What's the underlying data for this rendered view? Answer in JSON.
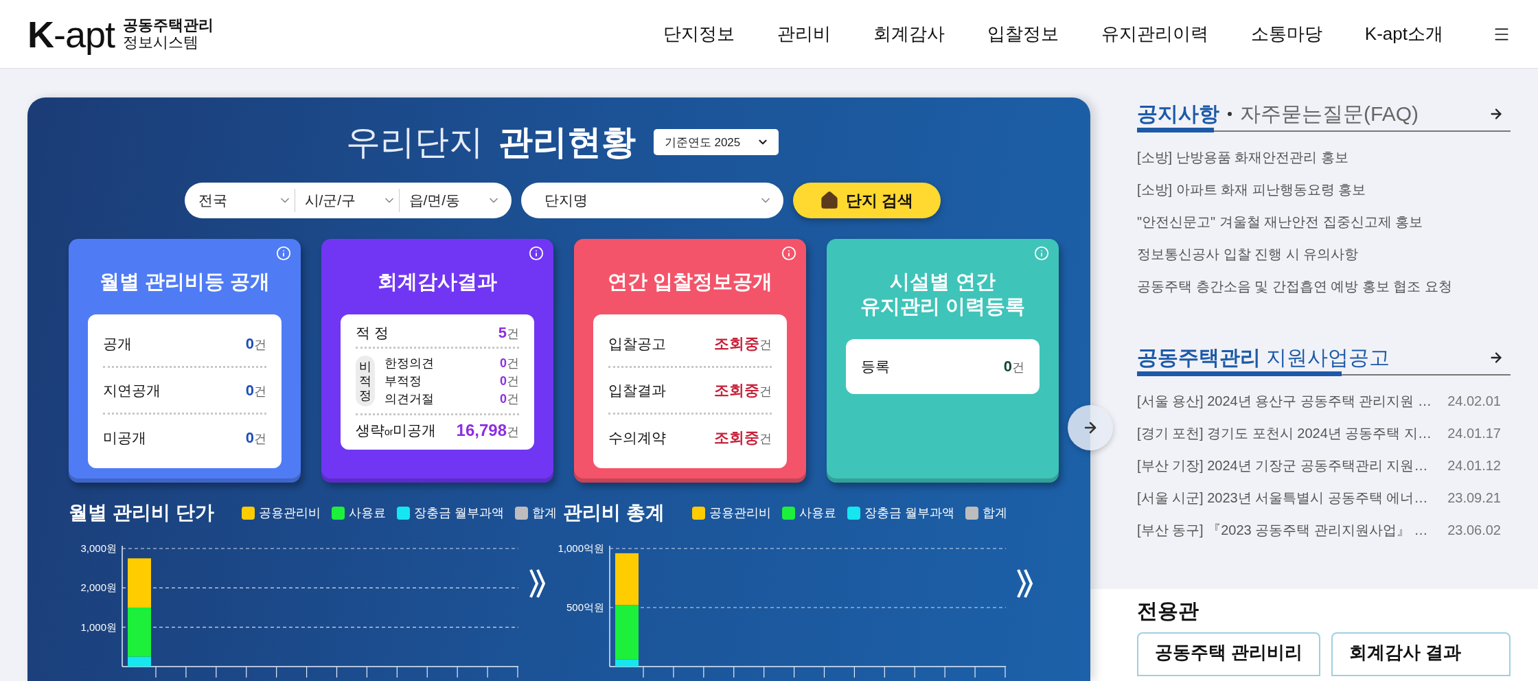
{
  "header": {
    "logo": {
      "mark": "**K**-apt",
      "line1": "공동주택관리",
      "line2": "정보시스템"
    },
    "nav": [
      {
        "label": "단지정보"
      },
      {
        "label": "관리비"
      },
      {
        "label": "회계감사"
      },
      {
        "label": "입찰정보"
      },
      {
        "label": "유지관리이력"
      },
      {
        "label": "소통마당"
      },
      {
        "label": "K-apt소개"
      }
    ]
  },
  "dashboard": {
    "title_light": "우리단지",
    "title_bold": "관리현황",
    "year_select": "기준연도 2025",
    "filters": [
      {
        "value": "전국"
      },
      {
        "value": "시/군/구"
      },
      {
        "value": "읍/면/동"
      }
    ],
    "complex_select": "단지명",
    "search_button": "단지 검색",
    "cards": [
      {
        "kind": "count",
        "title": "월별 관리비등 공개",
        "color": "#4f7cf4",
        "rows": [
          {
            "kind": "row",
            "label": "공개",
            "value": "0",
            "unit": "건"
          },
          {
            "kind": "row",
            "label": "지연공개",
            "value": "0",
            "unit": "건"
          },
          {
            "kind": "row",
            "label": "미공개",
            "value": "0",
            "unit": "건"
          }
        ]
      },
      {
        "kind": "audit",
        "title": "회계감사결과",
        "color": "#7136f4",
        "rows": [
          {
            "kind": "row",
            "label": "적 정",
            "value": "5",
            "unit": "건"
          },
          {
            "kind": "group",
            "label": "비적정",
            "items": [
              {
                "label": "한정의견",
                "value": "0",
                "unit": "건"
              },
              {
                "label": "부적정",
                "value": "0",
                "unit": "건"
              },
              {
                "label": "의견거절",
                "value": "0",
                "unit": "건"
              }
            ]
          },
          {
            "kind": "total",
            "label": "생략$_{or}$미공개",
            "value": "16,798",
            "unit": "건"
          }
        ]
      },
      {
        "kind": "bid",
        "title": "연간 입찰정보공개",
        "color": "#f3546a",
        "rows": [
          {
            "kind": "row",
            "label": "입찰공고",
            "value": "조회중",
            "unit": "건"
          },
          {
            "kind": "row",
            "label": "입찰결과",
            "value": "조회중",
            "unit": "건"
          },
          {
            "kind": "row",
            "label": "수의계약",
            "value": "조회중",
            "unit": "건"
          }
        ]
      },
      {
        "kind": "register",
        "title": "시설별 연간\n유지관리 이력등록",
        "color": "#3fc4b9",
        "rows": [
          {
            "kind": "row",
            "label": "등록",
            "value": "0",
            "unit": "건"
          }
        ]
      }
    ],
    "charts": [
      {
        "title": "월별 관리비 단가",
        "total_legend": {
          "label": "합계",
          "color": "#bdbdbd"
        },
        "chart_data": {
          "type": "bar",
          "stacked": true,
          "ylim": [
            0,
            3000
          ],
          "yticks": [
            {
              "value": 1000,
              "label": "1,000원"
            },
            {
              "value": 2000,
              "label": "2,000원"
            },
            {
              "value": 3000,
              "label": "3,000원"
            }
          ],
          "series": [
            {
              "name": "공용관리비",
              "color": "#ffcc00",
              "values": [
                1250,
                0,
                0,
                0,
                0,
                0,
                0,
                0,
                0,
                0,
                0,
                0,
                0
              ]
            },
            {
              "name": "사용료",
              "color": "#1cf03a",
              "values": [
                1250,
                0,
                0,
                0,
                0,
                0,
                0,
                0,
                0,
                0,
                0,
                0,
                0
              ]
            },
            {
              "name": "장충금 월부과액",
              "color": "#16e6f0",
              "values": [
                250,
                0,
                0,
                0,
                0,
                0,
                0,
                0,
                0,
                0,
                0,
                0,
                0
              ]
            }
          ]
        }
      },
      {
        "title": "관리비 총계",
        "total_legend": {
          "label": "합계",
          "color": "#bdbdbd"
        },
        "chart_data": {
          "type": "bar",
          "stacked": true,
          "ylim": [
            0,
            1000
          ],
          "yticks": [
            {
              "value": 500,
              "label": "500억원"
            },
            {
              "value": 1000,
              "label": "1,000억원"
            }
          ],
          "series": [
            {
              "name": "공용관리비",
              "color": "#ffcc00",
              "values": [
                440,
                0,
                0,
                0,
                0,
                0,
                0,
                0,
                0,
                0,
                0,
                0,
                0
              ]
            },
            {
              "name": "사용료",
              "color": "#1cf03a",
              "values": [
                460,
                0,
                0,
                0,
                0,
                0,
                0,
                0,
                0,
                0,
                0,
                0,
                0
              ]
            },
            {
              "name": "장충금 월부과액",
              "color": "#16e6f0",
              "values": [
                60,
                0,
                0,
                0,
                0,
                0,
                0,
                0,
                0,
                0,
                0,
                0,
                0
              ]
            }
          ]
        }
      }
    ]
  },
  "notices": {
    "tabs": [
      {
        "label": "공지사항",
        "selected": true
      },
      {
        "label": "자주묻는질문(FAQ)",
        "selected": false
      }
    ],
    "items": [
      "[소방] 난방용품 화재안전관리 홍보",
      "[소방] 아파트 화재 피난행동요령 홍보",
      "\"안전신문고\" 겨울철 재난안전 집중신고제 홍보",
      "정보통신공사 입찰 진행 시 유의사항",
      "공동주택 층간소음 및 간접흡연 예방 홍보 협조 요청"
    ]
  },
  "support": {
    "title_bold": "공동주택관리",
    "title_light": "지원사업공고",
    "items": [
      {
        "title": "[서울 용산] 2024년 용산구 공동주택 관리지원 …",
        "date": "24.02.01"
      },
      {
        "title": "[경기 포천] 경기도 포천시 2024년 공동주택 지…",
        "date": "24.01.17"
      },
      {
        "title": "[부산 기장] 2024년 기장군 공동주택관리 지원…",
        "date": "24.01.12"
      },
      {
        "title": "[서울 시군] 2023년 서울특별시 공동주택 에너…",
        "date": "23.09.21"
      },
      {
        "title": "[부산 동구] 『2023 공동주택 관리지원사업』 …",
        "date": "23.06.02"
      }
    ]
  },
  "dedicated": {
    "title": "전용관",
    "buttons": [
      "공동주택 관리비리",
      "회계감사 결과"
    ]
  }
}
